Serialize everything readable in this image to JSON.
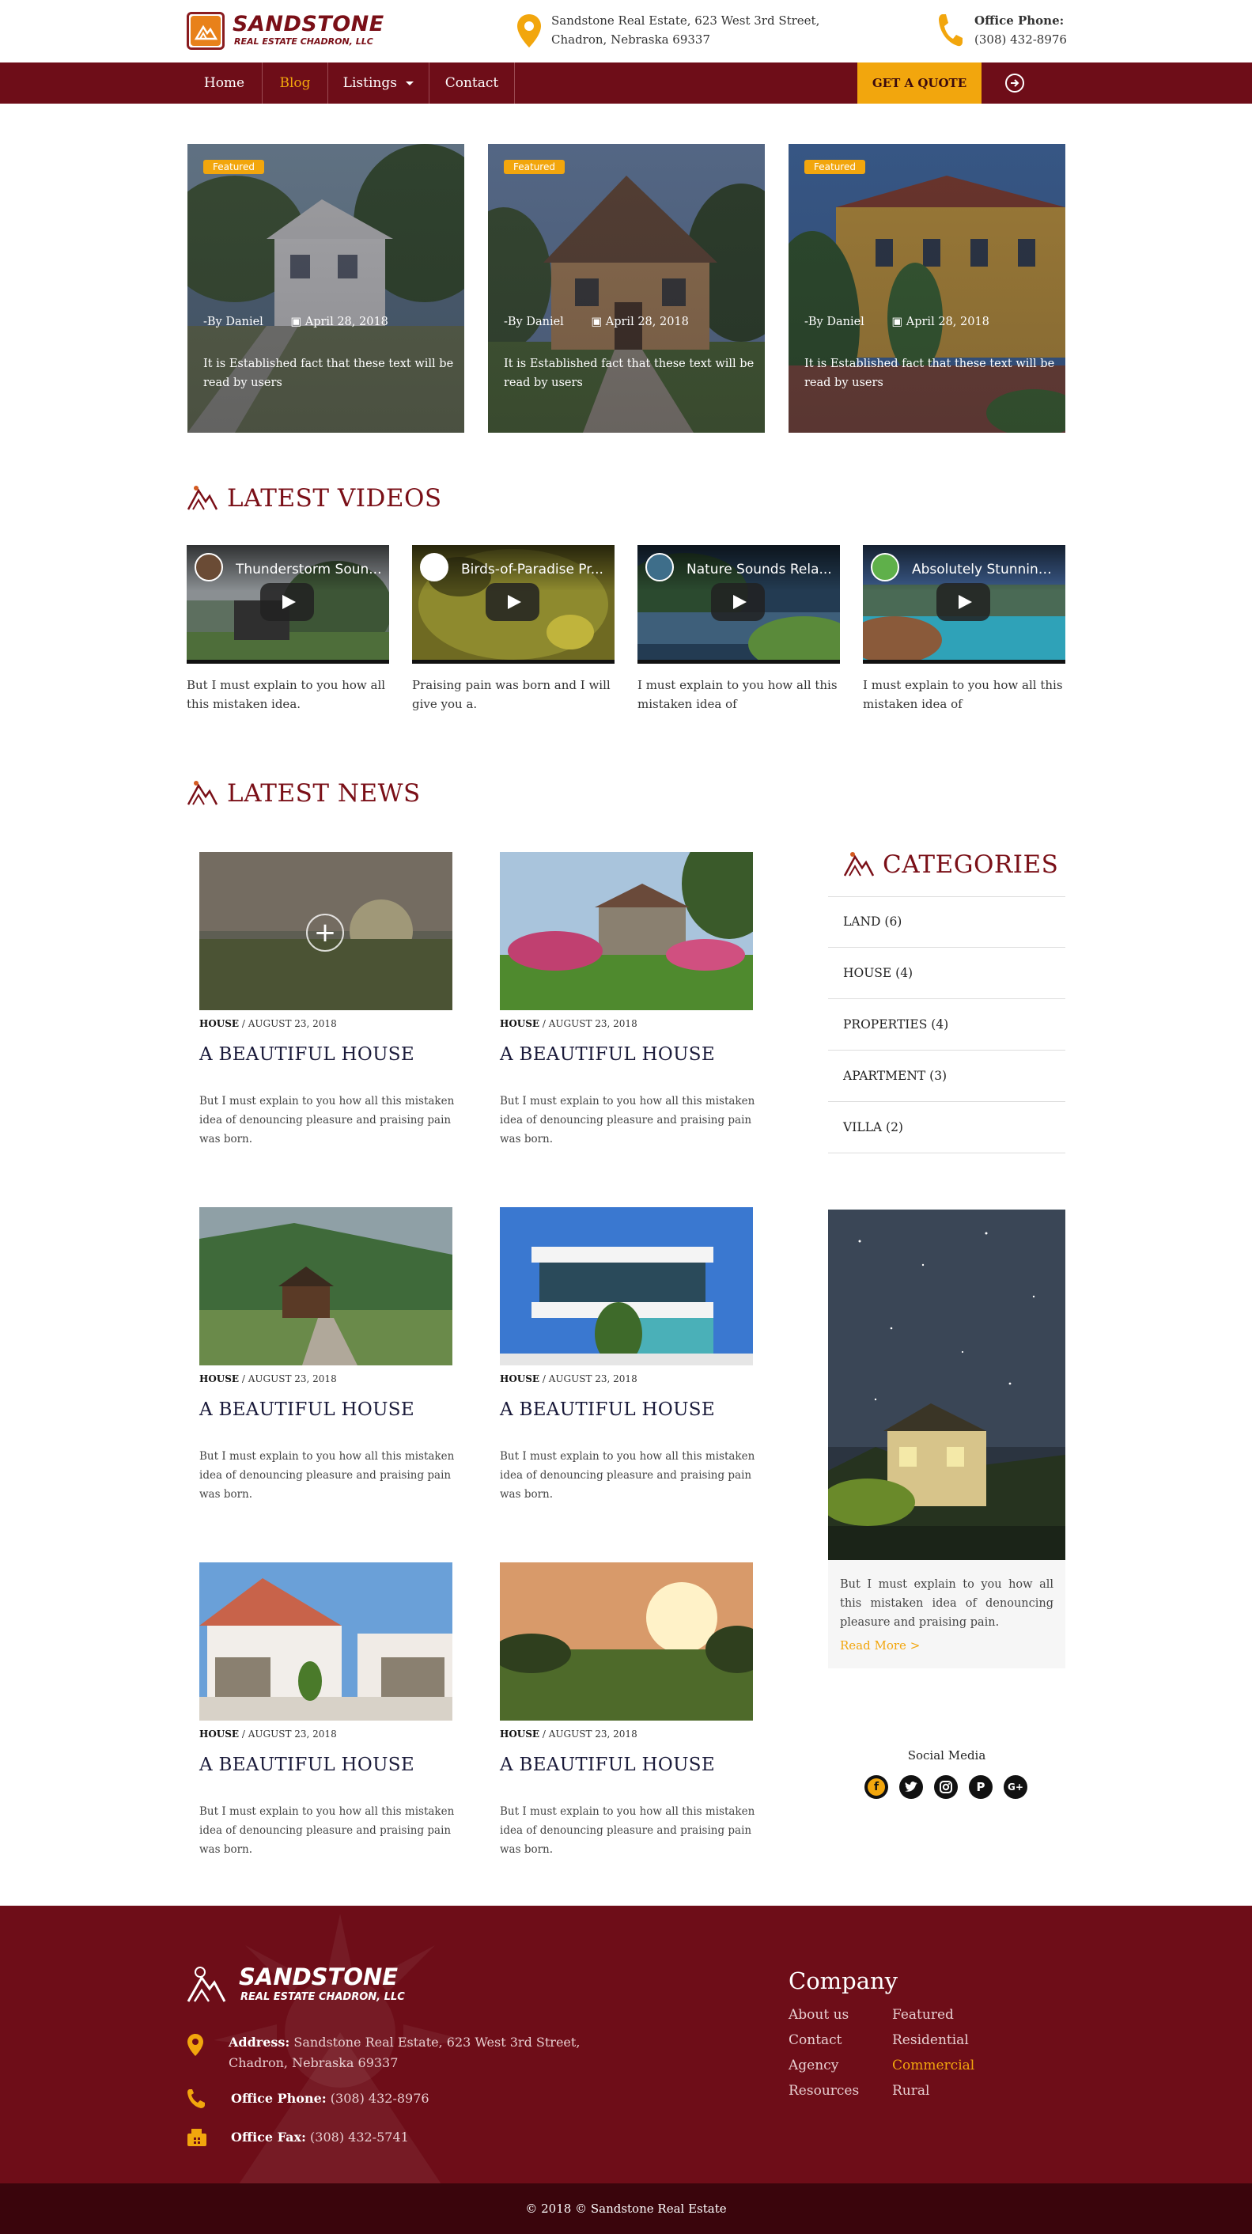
{
  "header": {
    "logo_name": "SANDSTONE",
    "logo_sub": "REAL ESTATE CHADRON, LLC",
    "address_line1": "Sandstone Real Estate, 623 West 3rd Street,",
    "address_line2": "Chadron, Nebraska 69337",
    "phone_label": "Office Phone:",
    "phone": "(308) 432-8976"
  },
  "nav": {
    "items": [
      {
        "label": "Home"
      },
      {
        "label": "Blog",
        "active": true
      },
      {
        "label": "Listings"
      },
      {
        "label": "Contact"
      }
    ],
    "quote_label": "GET A QUOTE",
    "accent": "#f2a60d",
    "bar_color": "#6e0d18"
  },
  "featured": [
    {
      "badge": "Featured",
      "author": "-By Daniel",
      "date": "April 28, 2018",
      "text": "It is Established fact that these text will be read by users"
    },
    {
      "badge": "Featured",
      "author": "-By Daniel",
      "date": "April 28, 2018",
      "text": "It is Established fact that these text will be read by users"
    },
    {
      "badge": "Featured",
      "author": "-By Daniel",
      "date": "April 28, 2018",
      "text": "It is Established fact that these text will be read by users"
    }
  ],
  "videos": {
    "title": "LATEST VIDEOS",
    "items": [
      {
        "title": "Thunderstorm Soun...",
        "caption": "But I must explain to you how all this mistaken idea."
      },
      {
        "title": "Birds-of-Paradise Pr...",
        "caption": "Praising pain was born and I will give you a."
      },
      {
        "title": "Nature Sounds Rela...",
        "caption": "I must explain to you how all this mistaken idea of"
      },
      {
        "title": "Absolutely Stunning ...",
        "caption": "I must explain to you how all this mistaken idea of"
      }
    ]
  },
  "news": {
    "title": "LATEST NEWS",
    "items": [
      {
        "category": "HOUSE",
        "date": " / AUGUST 23, 2018",
        "title": "A BEAUTIFUL HOUSE",
        "desc": "But I must explain to you how all this mistaken idea of denouncing pleasure and praising pain was born."
      },
      {
        "category": "HOUSE",
        "date": " / AUGUST 23, 2018",
        "title": "A BEAUTIFUL HOUSE",
        "desc": "But I must explain to you how all this mistaken idea of denouncing pleasure and praising pain was born."
      },
      {
        "category": "HOUSE",
        "date": " / AUGUST 23, 2018",
        "title": "A BEAUTIFUL HOUSE",
        "desc": "But I must explain to you how all this mistaken idea of denouncing pleasure and praising pain was born."
      },
      {
        "category": "HOUSE",
        "date": " / AUGUST 23, 2018",
        "title": "A BEAUTIFUL HOUSE",
        "desc": "But I must explain to you how all this mistaken idea of denouncing pleasure and praising pain was born."
      },
      {
        "category": "HOUSE",
        "date": " / AUGUST 23, 2018",
        "title": "A BEAUTIFUL HOUSE",
        "desc": "But I must explain to you how all this mistaken idea of denouncing pleasure and praising pain was born."
      },
      {
        "category": "HOUSE",
        "date": " / AUGUST 23, 2018",
        "title": "A BEAUTIFUL HOUSE",
        "desc": "But I must explain to you how all this mistaken idea of denouncing pleasure and praising pain was born."
      }
    ]
  },
  "categories": {
    "title": "CATEGORIES",
    "items": [
      "LAND (6)",
      "HOUSE (4)",
      "PROPERTIES (4)",
      "APARTMENT (3)",
      "VILLA (2)"
    ]
  },
  "promo": {
    "text": "But I must explain to you how all this mistaken idea of denouncing pleasure and praising pain.",
    "read_more": "Read More >"
  },
  "social": {
    "title": "Social Media",
    "icons": [
      "facebook-icon",
      "twitter-icon",
      "instagram-icon",
      "pinterest-icon",
      "google-plus-icon"
    ]
  },
  "footer": {
    "logo_name": "SANDSTONE",
    "logo_sub": "REAL ESTATE CHADRON, LLC",
    "address_label": "Address:",
    "address_line1": "Sandstone Real Estate, 623 West 3rd Street,",
    "address_line2": "Chadron, Nebraska 69337",
    "phone_label": "Office Phone:",
    "phone": "(308) 432-8976",
    "fax_label": "Office Fax:",
    "fax": "(308) 432-5741",
    "company_title": "Company",
    "links_col1": [
      "About us",
      "Contact",
      "Agency",
      "Resources"
    ],
    "links_col2": [
      "Featured",
      "Residential",
      "Commercial",
      "Rural"
    ],
    "copyright": "© 2018 © Sandstone Real Estate"
  }
}
